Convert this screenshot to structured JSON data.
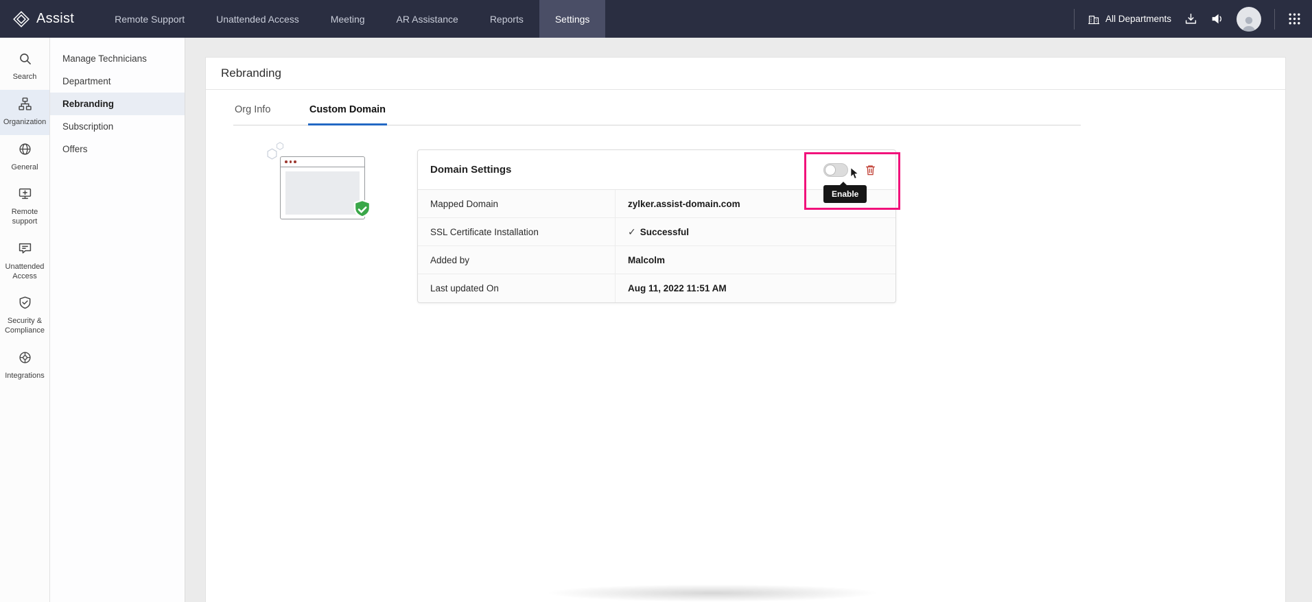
{
  "colors": {
    "navbar": "#2a2e41",
    "navbar_active": "#4a4e66",
    "accent_blue": "#2368c4",
    "annotation_pink": "#f1127b",
    "success_green": "#3aa749",
    "danger_red": "#bf3a2f"
  },
  "topnav": {
    "brand": "Assist",
    "items": [
      {
        "label": "Remote Support",
        "active": false
      },
      {
        "label": "Unattended Access",
        "active": false
      },
      {
        "label": "Meeting",
        "active": false
      },
      {
        "label": "AR Assistance",
        "active": false
      },
      {
        "label": "Reports",
        "active": false
      },
      {
        "label": "Settings",
        "active": true
      }
    ],
    "all_departments": "All Departments"
  },
  "rail": {
    "items": [
      {
        "label": "Search",
        "icon": "search-icon",
        "active": false
      },
      {
        "label": "Organization",
        "icon": "organization-icon",
        "active": true
      },
      {
        "label": "General",
        "icon": "globe-icon",
        "active": false
      },
      {
        "label": "Remote support",
        "icon": "remote-support-icon",
        "active": false
      },
      {
        "label": "Unattended Access",
        "icon": "unattended-access-icon",
        "active": false
      },
      {
        "label": "Security & Compliance",
        "icon": "security-icon",
        "active": false
      },
      {
        "label": "Integrations",
        "icon": "integrations-icon",
        "active": false
      }
    ]
  },
  "sidebar": {
    "items": [
      {
        "label": "Manage Technicians",
        "active": false
      },
      {
        "label": "Department",
        "active": false
      },
      {
        "label": "Rebranding",
        "active": true
      },
      {
        "label": "Subscription",
        "active": false
      },
      {
        "label": "Offers",
        "active": false
      }
    ]
  },
  "page": {
    "title": "Rebranding",
    "tabs": [
      {
        "label": "Org Info",
        "active": false
      },
      {
        "label": "Custom Domain",
        "active": true
      }
    ]
  },
  "domain_card": {
    "title": "Domain Settings",
    "tooltip": "Enable",
    "rows": [
      {
        "label": "Mapped Domain",
        "value": "zylker.assist-domain.com"
      },
      {
        "label": "SSL Certificate Installation",
        "value": "Successful",
        "has_check": true
      },
      {
        "label": "Added by",
        "value": "Malcolm"
      },
      {
        "label": "Last updated On",
        "value": "Aug 11, 2022 11:51 AM"
      }
    ]
  },
  "icons": {
    "check": "✓"
  }
}
